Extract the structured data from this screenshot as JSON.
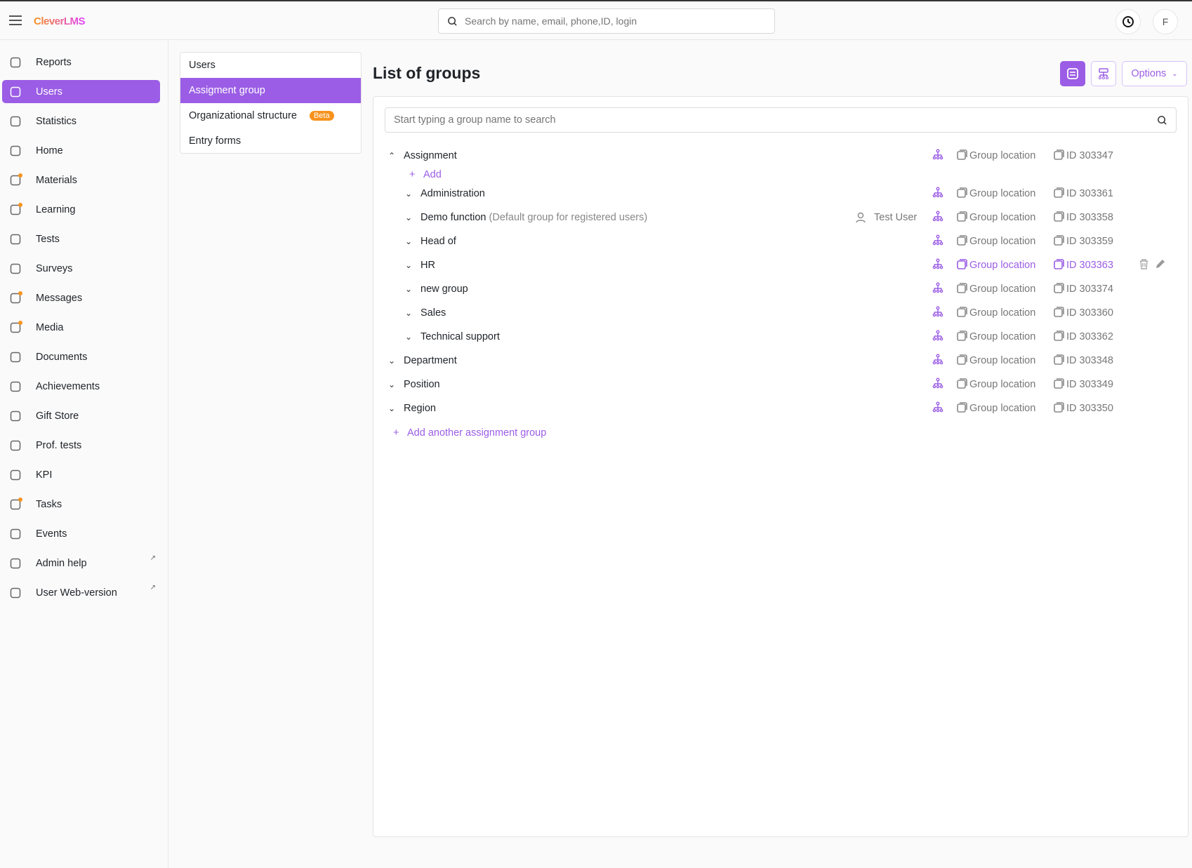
{
  "app": {
    "logo": "CleverLMS",
    "search_placeholder": "Search by name, email, phone,ID, login",
    "avatar_letter": "F"
  },
  "sidebar": {
    "items": [
      {
        "label": "Reports",
        "icon": "report-icon"
      },
      {
        "label": "Users",
        "icon": "users-icon",
        "active": true
      },
      {
        "label": "Statistics",
        "icon": "chart-line-icon"
      },
      {
        "label": "Home",
        "icon": "home-icon"
      },
      {
        "label": "Materials",
        "icon": "materials-icon",
        "dot": true
      },
      {
        "label": "Learning",
        "icon": "learning-icon",
        "dot": true
      },
      {
        "label": "Tests",
        "icon": "tests-icon"
      },
      {
        "label": "Surveys",
        "icon": "survey-icon"
      },
      {
        "label": "Messages",
        "icon": "messages-icon",
        "dot": true
      },
      {
        "label": "Media",
        "icon": "media-icon",
        "dot": true
      },
      {
        "label": "Documents",
        "icon": "documents-icon"
      },
      {
        "label": "Achievements",
        "icon": "trophy-icon"
      },
      {
        "label": "Gift Store",
        "icon": "gift-icon"
      },
      {
        "label": "Prof. tests",
        "icon": "prof-tests-icon"
      },
      {
        "label": "KPI",
        "icon": "kpi-icon"
      },
      {
        "label": "Tasks",
        "icon": "tasks-icon",
        "dot": true
      },
      {
        "label": "Events",
        "icon": "calendar-icon"
      },
      {
        "label": "Admin help",
        "icon": "star-icon",
        "external": true
      },
      {
        "label": "User Web-version",
        "icon": "monitor-icon",
        "external": true
      }
    ]
  },
  "subnav": {
    "items": [
      "Users",
      "Assigment group",
      "Organizational structure",
      "Entry forms"
    ],
    "beta": "Beta"
  },
  "main": {
    "title": "List of groups",
    "options_label": "Options",
    "search_placeholder": "Start typing a group name to search",
    "add_label": "Add",
    "add_another_label": "Add another assignment group",
    "location_label": "Group location",
    "groups": [
      {
        "name": "Assignment",
        "level": 0,
        "expanded": true,
        "id": "ID 303347"
      },
      {
        "name": "Administration",
        "level": 1,
        "id": "ID 303361"
      },
      {
        "name": "Demo function",
        "note": "(Default group for registered users)",
        "user": "Test User",
        "level": 1,
        "id": "ID 303358"
      },
      {
        "name": "Head of",
        "level": 1,
        "id": "ID 303359"
      },
      {
        "name": "HR",
        "level": 1,
        "id": "ID 303363",
        "highlighted": true
      },
      {
        "name": "new group",
        "level": 1,
        "id": "ID 303374"
      },
      {
        "name": "Sales",
        "level": 1,
        "id": "ID 303360"
      },
      {
        "name": "Technical support",
        "level": 1,
        "id": "ID 303362"
      },
      {
        "name": "Department",
        "level": 0,
        "id": "ID 303348"
      },
      {
        "name": "Position",
        "level": 0,
        "id": "ID 303349"
      },
      {
        "name": "Region",
        "level": 0,
        "id": "ID 303350"
      }
    ]
  },
  "colors": {
    "accent": "#9b5de5",
    "badge": "#f7931e"
  }
}
